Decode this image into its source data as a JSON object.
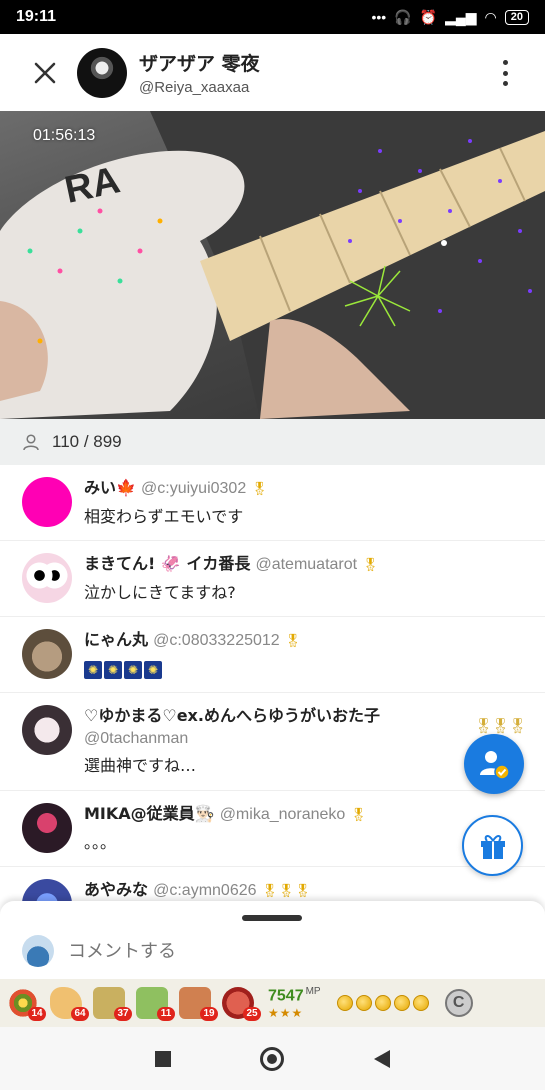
{
  "status_bar": {
    "time": "19:11",
    "icons": [
      "dots-icon",
      "headphones-icon",
      "alarm-icon",
      "signal-icon",
      "wifi-icon"
    ],
    "battery": "20"
  },
  "header": {
    "title": "ザアザア 零夜",
    "handle": "@Reiya_xaaxaa"
  },
  "video": {
    "elapsed": "01:56:13"
  },
  "viewers": {
    "count": "110 / 899"
  },
  "comments": [
    {
      "name": "みい🍁",
      "handle": "@c:yuiyui0302",
      "text": "相変わらずエモいです",
      "avatar_color": "#ff00b4"
    },
    {
      "name": "まきてん! 🦑 イカ番長",
      "handle": "@atemuatarot",
      "text": "泣かしにきてますね?",
      "avatar_color": "#f6d6e4"
    },
    {
      "name": "にゃん丸",
      "handle": "@c:08033225012",
      "text": "",
      "avatar_color": "#7a6a55"
    },
    {
      "name": "♡ゆかまる♡ex.めんへらゆうがいおた子",
      "handle": "@0tachanman",
      "text": "選曲神ですね…",
      "avatar_color": "#d9c7c1"
    },
    {
      "name": "MIKA@従業員👨🏻‍🍳",
      "handle": "@mika_noraneko",
      "text": "。。。",
      "avatar_color": "#5a2a45"
    },
    {
      "name": "あやみな",
      "handle": "@c:aymn0626",
      "text": "",
      "avatar_color": "#3a4aa0"
    }
  ],
  "comment_bar": {
    "placeholder": "コメントする"
  },
  "gifts": [
    {
      "icon": "firework-gift-icon",
      "count": "14",
      "color": "#6b8e23"
    },
    {
      "icon": "clap-gift-icon",
      "count": "64",
      "color": "#f0c070"
    },
    {
      "icon": "sake-100-gift-icon",
      "count": "37",
      "color": "#c9b060"
    },
    {
      "icon": "sake-10-gift-icon",
      "count": "11",
      "color": "#8fc060"
    },
    {
      "icon": "sake-50-gift-icon",
      "count": "19",
      "color": "#d08050"
    },
    {
      "icon": "steak-gift-icon",
      "count": "25",
      "color": "#c0302a"
    }
  ],
  "wallet": {
    "mp": "7547",
    "mp_unit": "MP",
    "stars": "★★★",
    "coin_label": "C"
  },
  "colors": {
    "accent": "#1a7be0",
    "badge": "#e0241b"
  }
}
